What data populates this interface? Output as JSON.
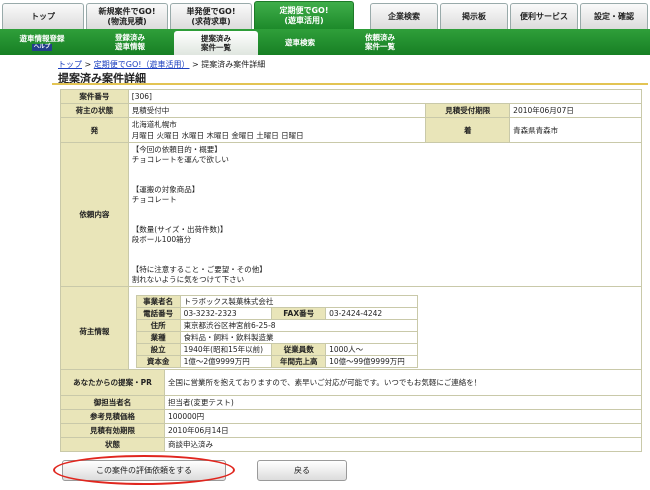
{
  "top_tabs": [
    {
      "l1": "トップ",
      "l2": ""
    },
    {
      "l1": "新規案件でGO!",
      "l2": "(物流見積)"
    },
    {
      "l1": "単発便でGO!",
      "l2": "(求荷求車)"
    },
    {
      "l1": "定期便でGO!",
      "l2": "(遊車活用)"
    },
    {
      "l1": "企業検索",
      "l2": ""
    },
    {
      "l1": "掲示板",
      "l2": ""
    },
    {
      "l1": "便利サービス",
      "l2": ""
    },
    {
      "l1": "設定・確認",
      "l2": ""
    }
  ],
  "sub_nav": [
    {
      "l1": "遊車情報登録",
      "l2": ""
    },
    {
      "l1": "登録済み",
      "l2": "遊車情報"
    },
    {
      "l1": "提案済み",
      "l2": "案件一覧"
    },
    {
      "l1": "遊車検索",
      "l2": ""
    },
    {
      "l1": "依頼済み",
      "l2": "案件一覧"
    }
  ],
  "help_badge": "ヘルプ",
  "breadcrumb": {
    "home": "トップ",
    "sep1": ">",
    "link": "定期便でGO!（遊車活用）",
    "sep2": ">",
    "current": "提案済み案件詳細"
  },
  "page_title": "提案済み案件詳細",
  "detail": {
    "case_no_label": "案件番号",
    "case_no": "[306]",
    "status_label": "荷主の状態",
    "status": "見積受付中",
    "deadline_label": "見積受付期限",
    "deadline": "2010年06月07日",
    "origin_label": "発",
    "origin_place": "北海道札幌市",
    "origin_days": "月曜日 火曜日 水曜日 木曜日 金曜日 土曜日 日曜日",
    "dest_label": "着",
    "dest": "青森県青森市",
    "request_label": "依頼内容",
    "request_lines": [
      "【今回の依頼目的・概要】",
      "チョコレートを運んで欲しい",
      "",
      "",
      "【運搬の対象商品】",
      "チョコレート",
      "",
      "",
      "【数量(サイズ・出荷件数)】",
      "段ボール100箱分",
      "",
      "",
      "【特に注意すること・ご要望・その他】",
      "割れないように気をつけて下さい"
    ],
    "shipper_label": "荷主情報"
  },
  "company": {
    "name_label": "事業者名",
    "name": "トラボックス製菓株式会社",
    "phone_label": "電話番号",
    "phone": "03-3232-2323",
    "fax_label": "FAX番号",
    "fax": "03-2424-4242",
    "address_label": "住所",
    "address": "東京都渋谷区神宮前6-25-8",
    "industry_label": "業種",
    "industry": "食料品・飼料・飲料製造業",
    "founded_label": "設立",
    "founded": "1940年(昭和15年以前)",
    "employees_label": "従業員数",
    "employees": "1000人～",
    "capital_label": "資本金",
    "capital": "1億～2億9999万円",
    "sales_label": "年間売上高",
    "sales": "10億～99億9999万円"
  },
  "proposal": {
    "pr_label": "あなたからの提案・PR",
    "pr": "全国に営業所を抱えておりますので、素早いご対応が可能です。いつでもお気軽にご連絡を！",
    "person_label": "御担当者名",
    "person": "担当者(変更テスト)",
    "price_label": "参考見積価格",
    "price": "100000円",
    "valid_label": "見積有効期限",
    "valid": "2010年06月14日",
    "state_label": "状態",
    "state": "商談申込済み"
  },
  "buttons": {
    "evaluate": "この案件の評価依頼をする",
    "back": "戻る"
  },
  "colors": {
    "green": "#1d8a2a",
    "label_bg": "#e9e5b9",
    "highlight": "#e0261e",
    "link": "#1a3fbf"
  }
}
